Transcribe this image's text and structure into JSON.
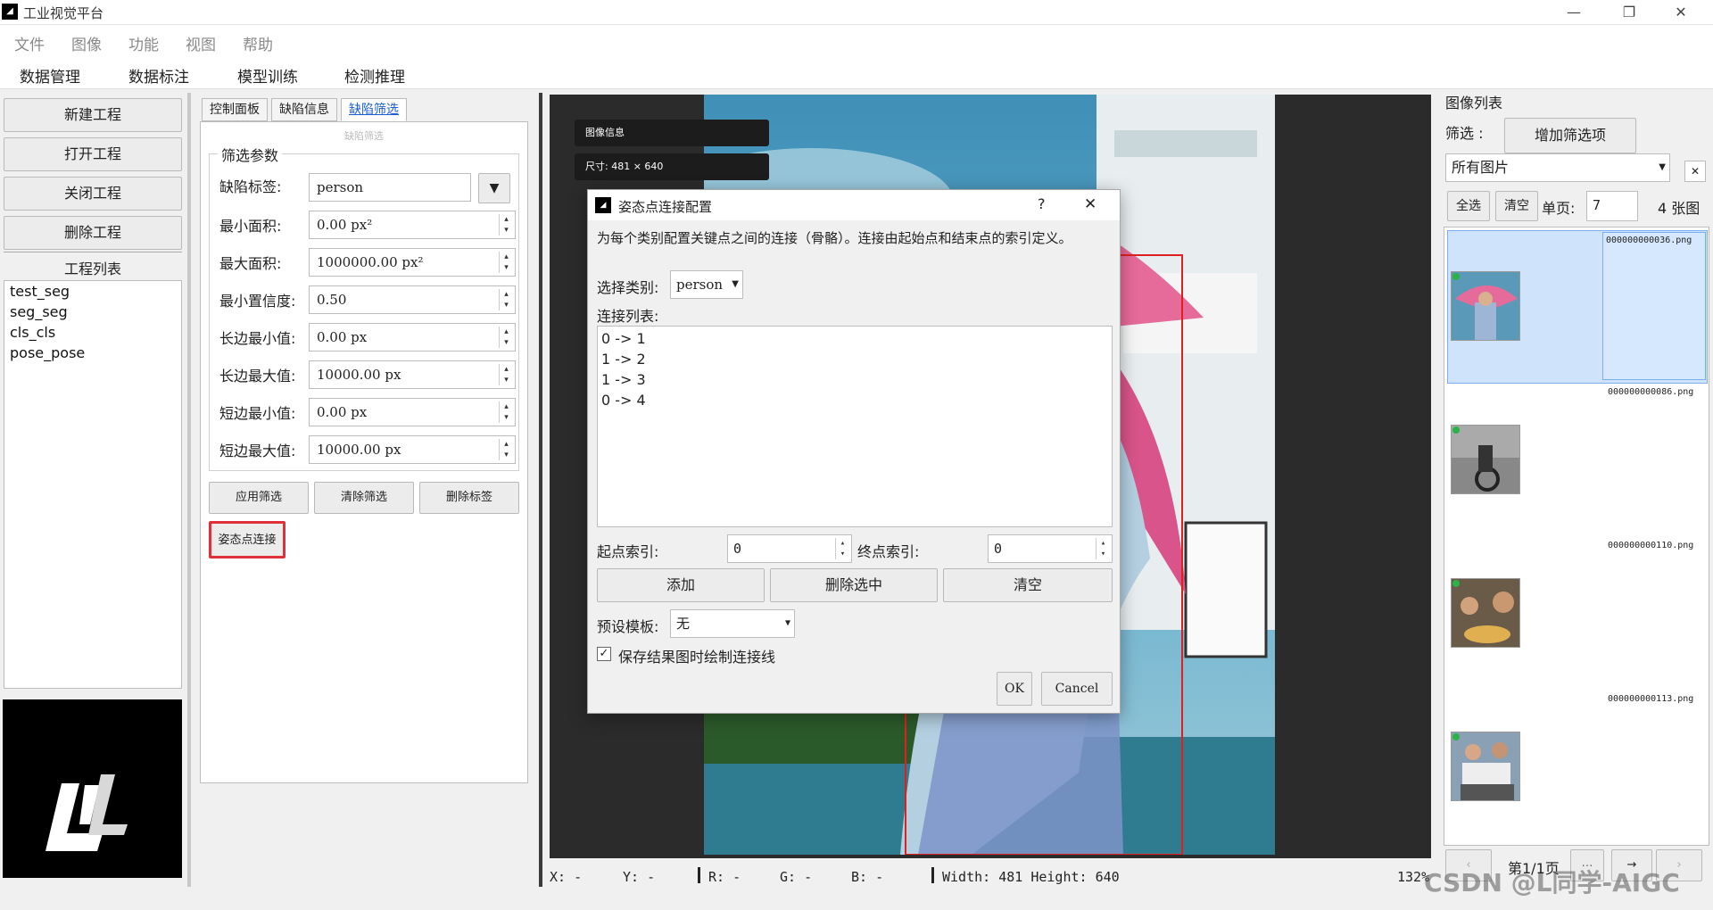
{
  "window": {
    "title": "工业视觉平台",
    "minimize": "—",
    "restore": "❐",
    "close": "✕"
  },
  "menu": [
    "文件",
    "图像",
    "功能",
    "视图",
    "帮助"
  ],
  "main_tabs": [
    "数据管理",
    "数据标注",
    "模型训练",
    "检测推理"
  ],
  "sidebar": {
    "buttons": [
      "新建工程",
      "打开工程",
      "关闭工程",
      "删除工程"
    ],
    "project_list_title": "工程列表",
    "projects": [
      "test_seg",
      "seg_seg",
      "cls_cls",
      "pose_pose"
    ]
  },
  "filter_panel": {
    "tabs": [
      "控制面板",
      "缺陷信息",
      "缺陷筛选"
    ],
    "active_tab": 2,
    "subtitle": "缺陷筛选",
    "group_title": "筛选参数",
    "fields": [
      {
        "label": "缺陷标签:",
        "value": "person"
      },
      {
        "label": "最小面积:",
        "value": "0.00 px²"
      },
      {
        "label": "最大面积:",
        "value": "1000000.00 px²"
      },
      {
        "label": "最小置信度:",
        "value": "0.50"
      },
      {
        "label": "长边最小值:",
        "value": "0.00 px"
      },
      {
        "label": "长边最大值:",
        "value": "10000.00 px"
      },
      {
        "label": "短边最小值:",
        "value": "0.00 px"
      },
      {
        "label": "短边最大值:",
        "value": "10000.00 px"
      }
    ],
    "buttons": [
      "应用筛选",
      "清除筛选",
      "删除标签"
    ],
    "pose_button": "姿态点连接"
  },
  "canvas": {
    "overlay": [
      "图像信息",
      "尺寸: 481 × 640"
    ]
  },
  "status": {
    "x": "X:    -",
    "y": "Y:    -",
    "r": "R:    -",
    "g": "G:    -",
    "b": "B:    -",
    "size": "Width:   481  Height:   640",
    "zoom": "132%"
  },
  "dialog": {
    "title": "姿态点连接配置",
    "help": "?",
    "close": "✕",
    "description": "为每个类别配置关键点之间的连接（骨骼）。连接由起始点和结束点的索引定义。",
    "category_label": "选择类别:",
    "category_value": "person",
    "list_label": "连接列表:",
    "connections": [
      "0 -> 1",
      "1 -> 2",
      "1 -> 3",
      "0 -> 4"
    ],
    "start_label": "起点索引:",
    "start_value": "0",
    "end_label": "终点索引:",
    "end_value": "0",
    "buttons": [
      "添加",
      "删除选中",
      "清空"
    ],
    "template_label": "预设模板:",
    "template_value": "无",
    "checkbox_label": "保存结果图时绘制连接线",
    "checkbox_checked": true,
    "ok": "OK",
    "cancel": "Cancel"
  },
  "image_list": {
    "title": "图像列表",
    "filter_label": "筛选 :",
    "add_filter": "增加筛选项",
    "filter_value": "所有图片",
    "select_all": "全选",
    "clear": "清空",
    "page_size_label": "单页:",
    "page_size": "7",
    "count": "4 张图",
    "files": [
      "000000000036.png",
      "000000000086.png",
      "000000000110.png",
      "000000000113.png"
    ],
    "page_text": "第1/1页",
    "watermark": "CSDN @L同学-AIGC"
  }
}
